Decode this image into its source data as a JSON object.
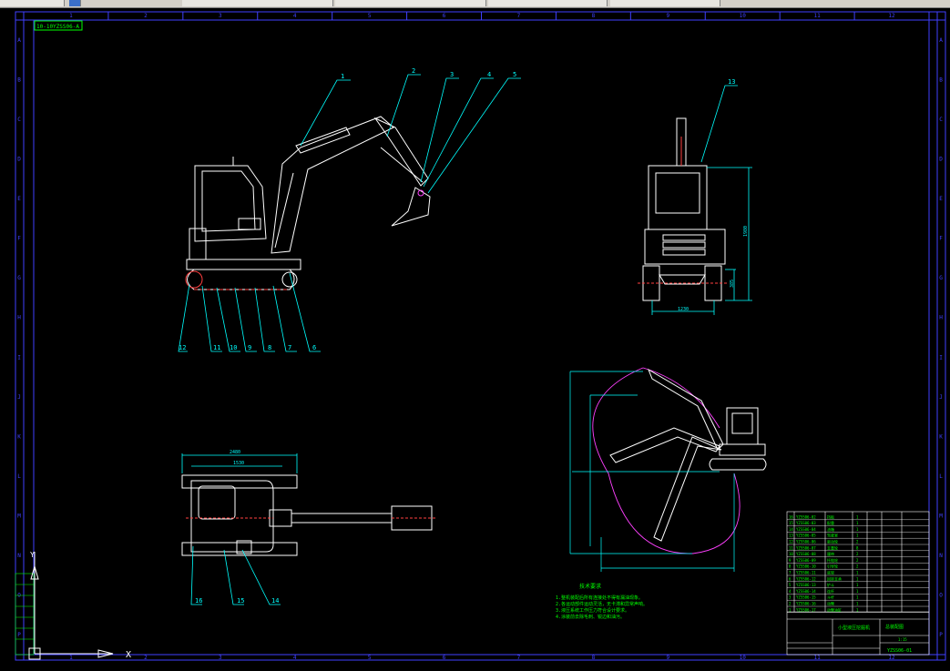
{
  "drawing": {
    "title_block_left": "10-10YZSS06-A",
    "col_labels": [
      "1",
      "2",
      "3",
      "4",
      "5",
      "6",
      "7",
      "8",
      "9",
      "10",
      "11",
      "12"
    ],
    "row_labels": [
      "A",
      "B",
      "C",
      "D",
      "E",
      "F",
      "G",
      "H",
      "I",
      "J",
      "K",
      "L",
      "M",
      "N",
      "O",
      "P",
      "Q",
      "R",
      "S",
      "T",
      "U",
      "V",
      "W",
      "X",
      "Y",
      "Z",
      "A",
      "B",
      "C",
      "D",
      "E",
      "F",
      "G",
      "H"
    ],
    "callouts_side": [
      "1",
      "2",
      "3",
      "4",
      "5"
    ],
    "callouts_bottom": [
      "12",
      "11",
      "10",
      "9",
      "8",
      "7",
      "6"
    ],
    "callout_front": "13",
    "callouts_plan": [
      "16",
      "15",
      "14"
    ],
    "dim_front_height": "1980",
    "dim_front_width": "1230",
    "dim_front_track": "385",
    "dim_plan_total": "2480",
    "dim_plan_inner": "1530",
    "notes_title": "技术要求",
    "notes": [
      "1.整机装配后所有连接处不得有漏油现象。",
      "2.各运动部件运动灵活，无卡滞和异常声响。",
      "3.液压系统工作压力符合设计要求。",
      "4.涂装前去除毛刺、锐边和油污。"
    ],
    "title_block": {
      "name": "小型液压挖掘机",
      "company": "总装配图",
      "drawing_no": "YZSS06-01",
      "scale": "1:15"
    },
    "bom_rows": [
      [
        "16",
        "YZSS06-02",
        "挡板",
        "1"
      ],
      [
        "15",
        "YZSS06-03",
        "配重",
        "1"
      ],
      [
        "14",
        "YZSS06-04",
        "油箱",
        "1"
      ],
      [
        "13",
        "YZSS06-05",
        "驾驶室",
        "1"
      ],
      [
        "12",
        "YZSS06-06",
        "驱动轮",
        "2"
      ],
      [
        "11",
        "YZSS06-07",
        "支重轮",
        "8"
      ],
      [
        "10",
        "YZSS06-08",
        "履带",
        "2"
      ],
      [
        "9",
        "YZSS06-09",
        "托链轮",
        "2"
      ],
      [
        "8",
        "YZSS06-10",
        "引导轮",
        "2"
      ],
      [
        "7",
        "YZSS06-11",
        "底架",
        "1"
      ],
      [
        "6",
        "YZSS06-12",
        "回转支承",
        "1"
      ],
      [
        "5",
        "YZSS06-13",
        "铲斗",
        "1"
      ],
      [
        "4",
        "YZSS06-14",
        "连杆",
        "1"
      ],
      [
        "3",
        "YZSS06-15",
        "斗杆",
        "1"
      ],
      [
        "2",
        "YZSS06-16",
        "动臂",
        "1"
      ],
      [
        "1",
        "YZSS06-17",
        "动臂油缸",
        "1"
      ]
    ],
    "ucs_label": "X",
    "ucs_label_y": "Y"
  }
}
